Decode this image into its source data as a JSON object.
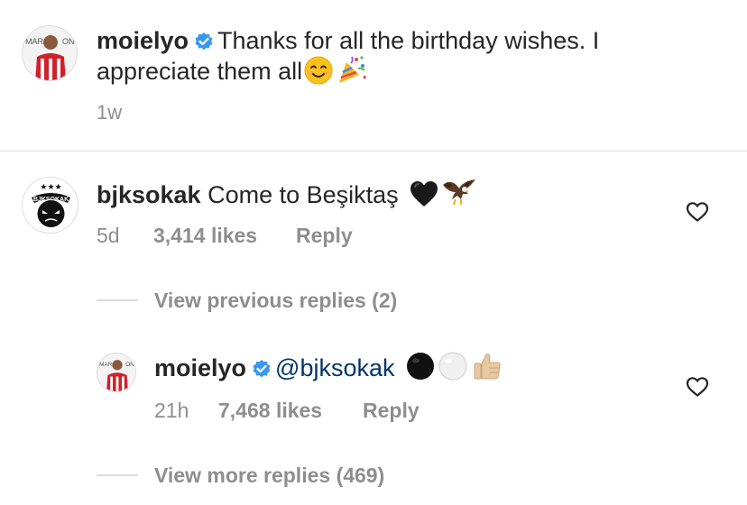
{
  "caption": {
    "username": "moielyo",
    "text_line1": "Thanks for all the birthday wishes. I",
    "text_line2": "appreciate them all",
    "age": "1w"
  },
  "comment": {
    "username": "bjksokak",
    "text": "Come to Beşiktaş",
    "age": "5d",
    "likes": "3,414 likes",
    "reply_label": "Reply",
    "avatar_logo_text": "BJKSOKAK"
  },
  "view_previous_replies": "View previous replies (2)",
  "reply": {
    "username": "moielyo",
    "mention": "@bjksokak",
    "age": "21h",
    "likes": "7,468 likes",
    "reply_label": "Reply"
  },
  "view_more_replies": "View more replies (469)",
  "colors": {
    "verified": "#3897f0",
    "mention": "#003569",
    "muted": "#8e8e8e"
  },
  "icons": [
    "verified-badge-icon",
    "heart-icon",
    "smiling-face-emoji",
    "party-popper-emoji",
    "black-heart-emoji",
    "eagle-emoji",
    "black-circle-emoji",
    "white-circle-emoji",
    "thumbs-up-emoji"
  ]
}
